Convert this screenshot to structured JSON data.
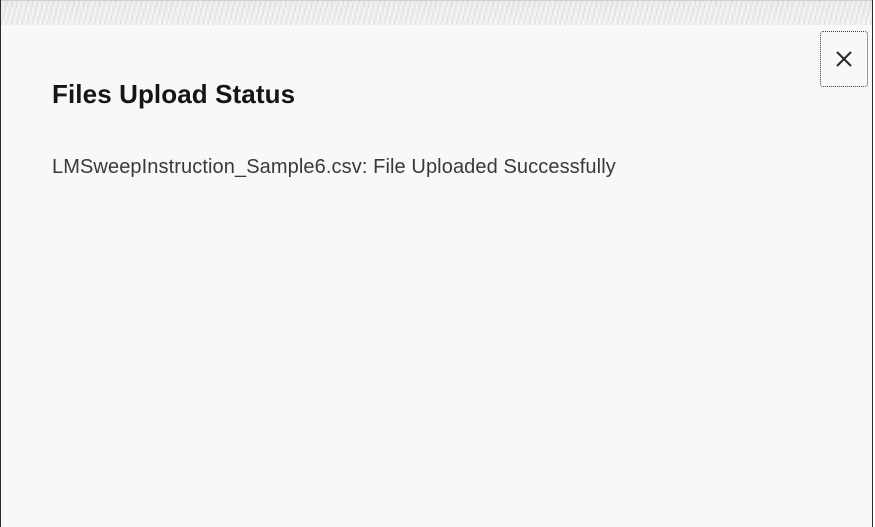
{
  "dialog": {
    "title": "Files Upload Status",
    "close_icon": "close-icon",
    "messages": [
      "LMSweepInstruction_Sample6.csv: File Uploaded Successfully"
    ]
  },
  "colors": {
    "dialog_background": "#f9f8f7",
    "title_text": "#161513",
    "body_text": "#3a3937",
    "border": "#2b2b2b"
  }
}
